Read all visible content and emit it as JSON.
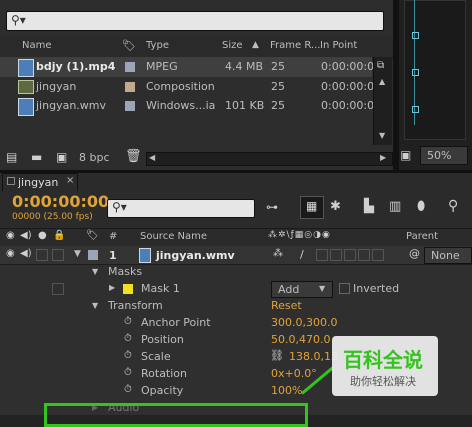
{
  "project": {
    "columns": {
      "name": "Name",
      "type": "Type",
      "size": "Size",
      "frame_rate": "Frame R...",
      "in_point": "In Point"
    },
    "items": [
      {
        "name": "bdjy (1).mp4",
        "type": "MPEG",
        "size": "4.4 MB",
        "fps": "25",
        "in": "0:00:00:00",
        "swatch": "#9aa6b7"
      },
      {
        "name": "jingyan",
        "type": "Composition",
        "size": "",
        "fps": "25",
        "in": "0:00:00:00",
        "swatch": "#c1a98d"
      },
      {
        "name": "jingyan.wmv",
        "type": "Windows...ia",
        "size": "101 KB",
        "fps": "25",
        "in": "0:00:00:00",
        "swatch": "#9aa6b7"
      }
    ],
    "bpc": "8 bpc"
  },
  "viewer": {
    "zoom": "50%"
  },
  "timeline": {
    "tab": "jingyan",
    "timecode": "0:00:00:00",
    "frames": "00000 (25.00 fps)",
    "columns": {
      "num": "#",
      "source": "Source Name",
      "parent": "Parent"
    },
    "layer": {
      "num": "1",
      "name": "jingyan.wmv",
      "parent": "None"
    },
    "props": {
      "masks": "Masks",
      "mask1": "Mask 1",
      "mode": "Add",
      "inverted": "Inverted",
      "transform": "Transform",
      "reset": "Reset",
      "anchor": "Anchor Point",
      "anchor_v": "300.0,300.0",
      "position": "Position",
      "position_v": "50.0,470.0",
      "scale": "Scale",
      "scale_v": "138.0,13",
      "rotation": "Rotation",
      "rotation_v": "0x+0.0°",
      "opacity": "Opacity",
      "opacity_v": "100%",
      "audio": "Audio"
    }
  },
  "watermark": {
    "title": "百科全说",
    "subtitle": "助你轻松解决"
  },
  "colors": {
    "accent": "#e0a338",
    "highlight": "#35c31d",
    "value": "#e0a338"
  }
}
